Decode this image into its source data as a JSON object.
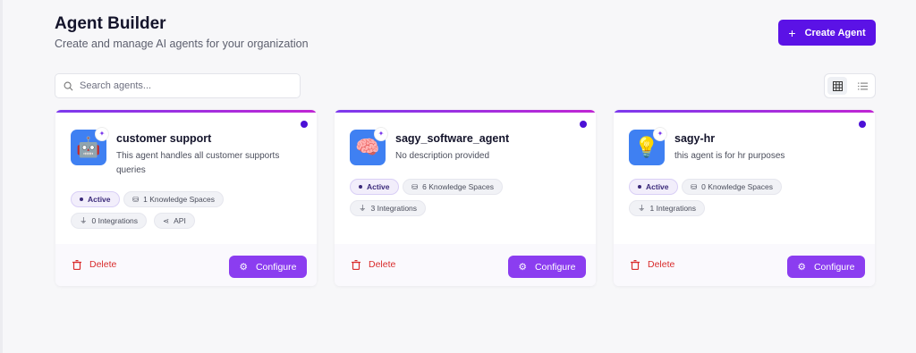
{
  "header": {
    "title": "Agent Builder",
    "subtitle": "Create and manage AI agents for your organization",
    "create_label": "Create Agent"
  },
  "search": {
    "placeholder": "Search agents..."
  },
  "view_toggle": {
    "selected": "grid",
    "options": [
      "grid",
      "list"
    ]
  },
  "colors": {
    "accent": "#5b12e6",
    "configure": "#8b3df0",
    "delete": "#d92d2d",
    "avatar_bg": "#3f80f2"
  },
  "agents": [
    {
      "name": "customer support",
      "description": "This agent handles all customer supports queries",
      "icon": "robot-icon",
      "status": "Active",
      "knowledge": "1 Knowledge Spaces",
      "integrations": "0 Integrations",
      "api": "API",
      "delete_label": "Delete",
      "configure_label": "Configure"
    },
    {
      "name": "sagy_software_agent",
      "description": "No description provided",
      "icon": "brain-icon",
      "status": "Active",
      "knowledge": "6 Knowledge Spaces",
      "integrations": "3 Integrations",
      "delete_label": "Delete",
      "configure_label": "Configure"
    },
    {
      "name": "sagy-hr",
      "description": "this agent is for hr purposes",
      "icon": "lightbulb-icon",
      "status": "Active",
      "knowledge": "0 Knowledge Spaces",
      "integrations": "1 Integrations",
      "delete_label": "Delete",
      "configure_label": "Configure"
    }
  ]
}
